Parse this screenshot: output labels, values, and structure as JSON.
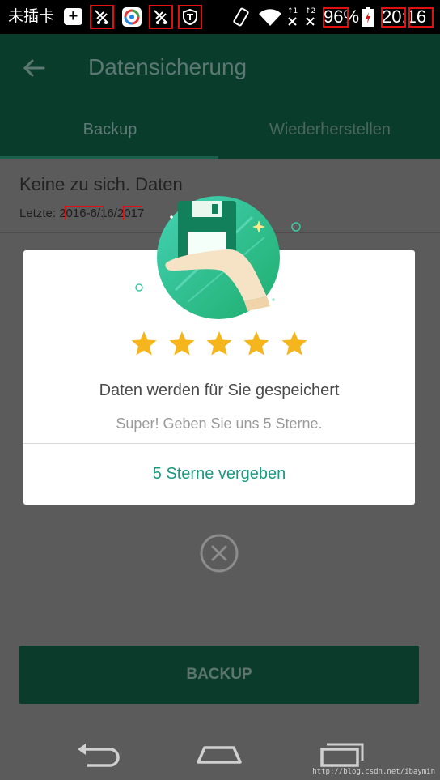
{
  "status_bar": {
    "carrier": "未插卡",
    "battery": "96%",
    "time": "20:16",
    "icons": [
      "plus-icon",
      "app-icon-1",
      "browser-icon",
      "app-icon-2",
      "shield-icon",
      "vibrate-icon",
      "wifi-icon",
      "sim1-icon",
      "sim2-icon",
      "battery-icon"
    ]
  },
  "app_bar": {
    "back_icon": "arrow-left-icon",
    "title": "Datensicherung"
  },
  "tabs": [
    {
      "label": "Backup",
      "selected": true
    },
    {
      "label": "Wiederherstellen",
      "selected": false
    }
  ],
  "content": {
    "status_title": "Keine zu sich. Daten",
    "last_backup": "Letzte: 2016-6/16/2017",
    "backup_button": "BACKUP"
  },
  "dialog": {
    "illustration": "floppy-disk-in-hand-icon",
    "star_count": 5,
    "headline": "Daten werden für Sie gespeichert",
    "subline": "Super! Geben Sie uns 5 Sterne.",
    "action": "5 Sterne vergeben",
    "close_icon": "close-circle-icon"
  },
  "nav_bar": {
    "buttons": [
      "back-icon",
      "home-icon",
      "recents-icon"
    ],
    "watermark": "http://blog.csdn.net/ibaymin"
  },
  "colors": {
    "app_bar": "#0a3c2c",
    "accent": "#1a9a82",
    "star": "#f5b51c",
    "dim_overlay": "#5b5b5b"
  }
}
